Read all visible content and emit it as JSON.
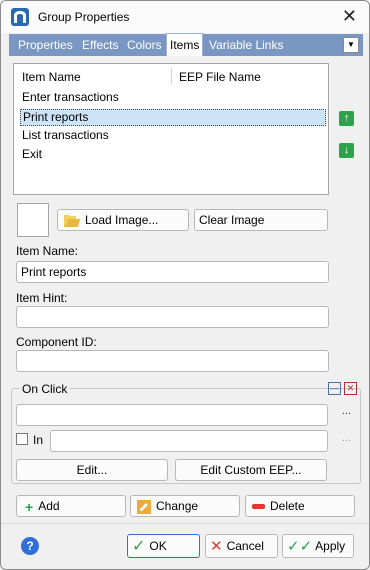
{
  "window": {
    "title": "Group Properties"
  },
  "tabs": [
    "Properties",
    "Effects",
    "Colors",
    "Items",
    "Variable Links"
  ],
  "active_tab": "Items",
  "items_list": {
    "columns": [
      "Item Name",
      "EEP File Name"
    ],
    "rows": [
      "Enter transactions",
      "Print reports",
      "List transactions",
      "Exit"
    ],
    "selected_index": 1
  },
  "image_buttons": {
    "load": "Load Image...",
    "clear": "Clear Image"
  },
  "item_name": {
    "label": "Item Name:",
    "value": "Print reports"
  },
  "item_hint": {
    "label": "Item Hint:",
    "value": ""
  },
  "component_id": {
    "label": "Component ID:",
    "value": ""
  },
  "on_click": {
    "title": "On Click",
    "action_value": "",
    "in_label": "In",
    "in_value": "",
    "edit_label": "Edit...",
    "edit_custom_label": "Edit Custom EEP...",
    "ellipsis": "..."
  },
  "list_actions": {
    "add": "Add",
    "change": "Change",
    "delete": "Delete"
  },
  "footer": {
    "help": "?",
    "ok": "OK",
    "cancel": "Cancel",
    "apply": "Apply"
  },
  "colors": {
    "tab_strip": "#7a97c4",
    "selection": "#cde4f7",
    "accent_green": "#2ea24a"
  }
}
